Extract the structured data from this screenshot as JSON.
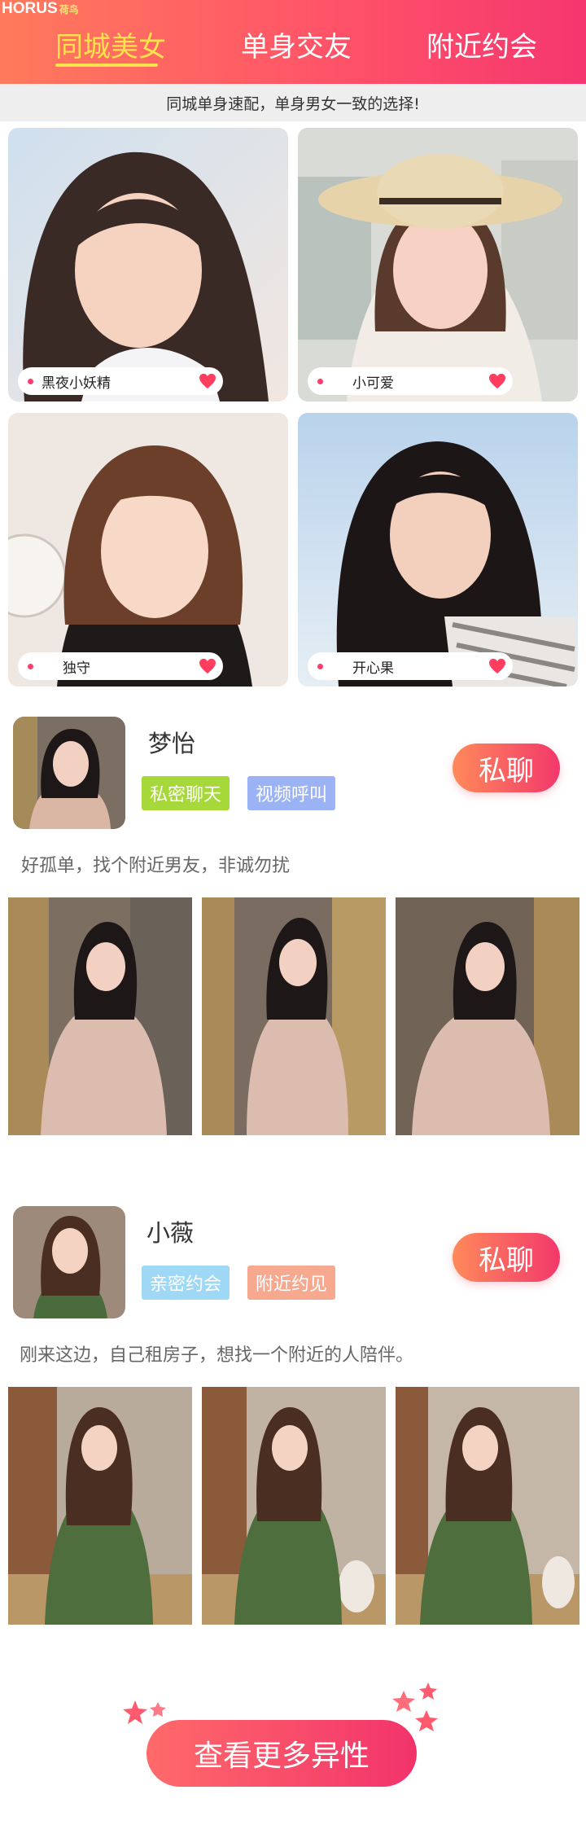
{
  "header": {
    "logo_text": "HORUS",
    "logo_sub": "荷鸟",
    "tabs": [
      {
        "label": "同城美女",
        "active": true
      },
      {
        "label": "单身交友",
        "active": false
      },
      {
        "label": "附近约会",
        "active": false
      }
    ]
  },
  "banner": {
    "text": "同城单身速配，单身男女一致的选择!"
  },
  "grid": {
    "cards": [
      {
        "name": "黑夜小妖精"
      },
      {
        "name": "小可爱"
      },
      {
        "name": "独守"
      },
      {
        "name": "开心果"
      }
    ]
  },
  "profiles": [
    {
      "name": "梦怡",
      "tags": [
        {
          "label": "私密聊天",
          "color": "#a6d83a"
        },
        {
          "label": "视频呼叫",
          "color": "#9bb3f5"
        }
      ],
      "chat_label": "私聊",
      "bio": "好孤单，找个附近男友，非诚勿扰"
    },
    {
      "name": "小薇",
      "tags": [
        {
          "label": "亲密约会",
          "color": "#9fd8f5"
        },
        {
          "label": "附近约见",
          "color": "#f6a98f"
        }
      ],
      "chat_label": "私聊",
      "bio": "刚来这边，自己租房子，想找一个附近的人陪伴。"
    }
  ],
  "footer": {
    "more_label": "查看更多异性"
  },
  "colors": {
    "header_start": "#ff7a5c",
    "header_end": "#f5366f",
    "active_tab": "#ffe24d",
    "accent": "#f2386b"
  }
}
